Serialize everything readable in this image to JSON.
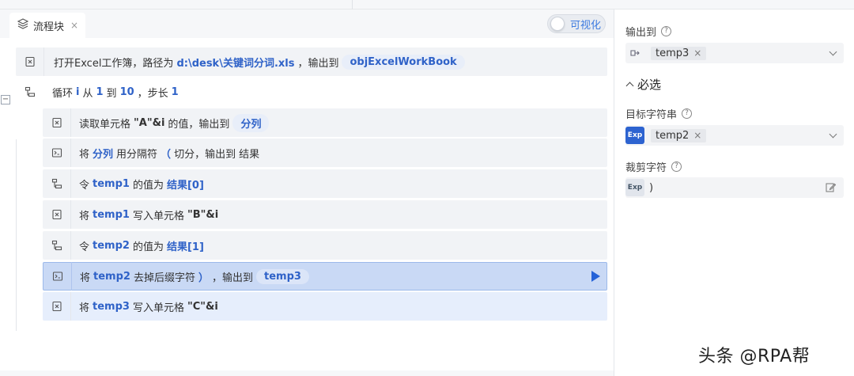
{
  "tab": {
    "label": "流程块",
    "close": "×"
  },
  "toggle": {
    "label": "可视化"
  },
  "collapse_symbol": "−",
  "rows": [
    {
      "id": "r1",
      "segments": [
        "打开Excel工作簿，路径为",
        "d:\\desk\\关键词分词.xls",
        "，输出到",
        "objExcelWorkBook"
      ]
    },
    {
      "id": "r2",
      "segments": [
        "循环",
        "i",
        "从",
        "1",
        "到",
        "10",
        "，步长",
        "1"
      ]
    },
    {
      "id": "r3",
      "segments": [
        "读取单元格",
        "\"A\"&i",
        "的值，输出到",
        "分列"
      ]
    },
    {
      "id": "r4",
      "segments": [
        "将",
        "分列",
        "用分隔符",
        "（",
        "切分，输出到",
        "结果"
      ]
    },
    {
      "id": "r5",
      "segments": [
        "令",
        "temp1",
        "的值为",
        "结果[0]"
      ]
    },
    {
      "id": "r6",
      "segments": [
        "将",
        "temp1",
        "写入单元格",
        "\"B\"&i"
      ]
    },
    {
      "id": "r7",
      "segments": [
        "令",
        "temp2",
        "的值为",
        "结果[1]"
      ]
    },
    {
      "id": "r8",
      "segments": [
        "将",
        "temp2",
        "去掉后缀字符",
        "）",
        "，输出到",
        "temp3"
      ]
    },
    {
      "id": "r9",
      "segments": [
        "将",
        "temp3",
        "写入单元格",
        "\"C\"&i"
      ]
    }
  ],
  "props": {
    "output_label": "输出到",
    "output_value": "temp3",
    "section_title": "必选",
    "target_label": "目标字符串",
    "target_value": "temp2",
    "trim_label": "裁剪字符",
    "trim_value": ")",
    "exp_badge": "Exp",
    "help_symbol": "?",
    "tag_close": "×"
  },
  "watermark": "头条 @RPA帮",
  "colors": {
    "accent": "#2f62c8",
    "selected_row": "#c9d9f5",
    "play": "#2462d8"
  }
}
